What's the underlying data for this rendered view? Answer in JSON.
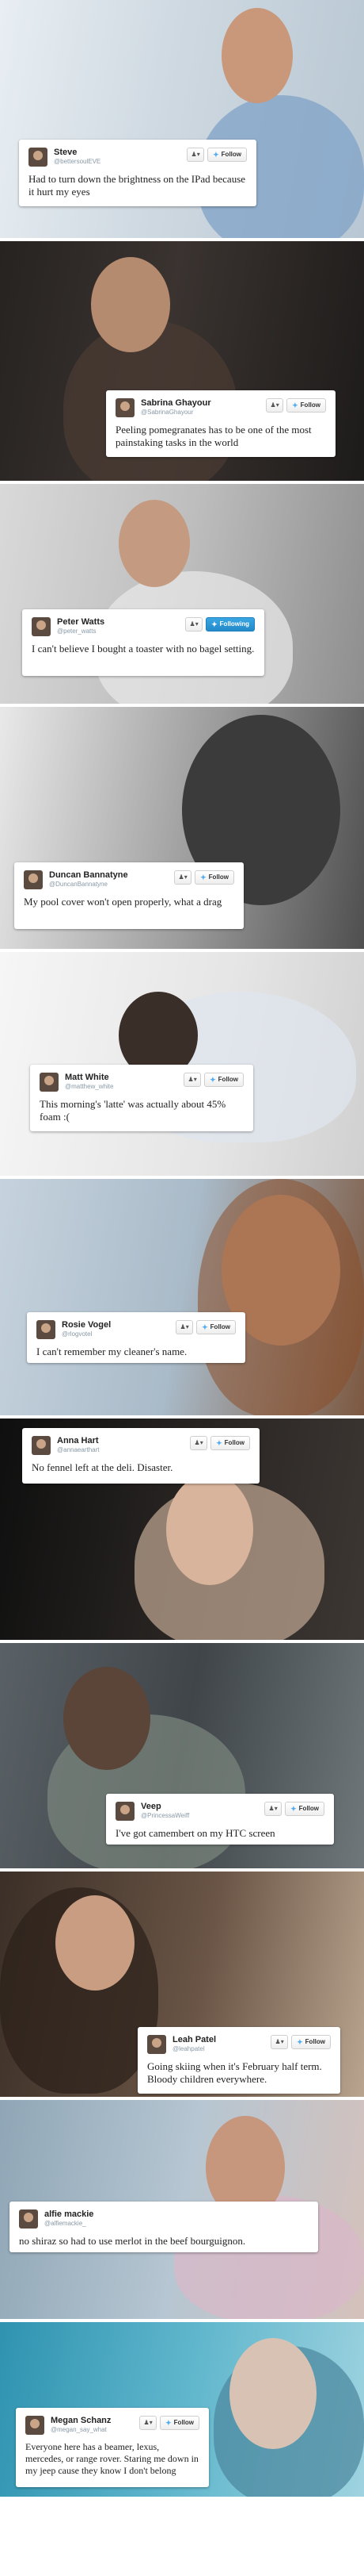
{
  "follow_label": "Follow",
  "following_label": "Following",
  "tweets": [
    {
      "name": "Steve",
      "handle": "@bettersoulEVE",
      "text": "Had to turn down the brightness on the IPad because it hurt my eyes",
      "following": false
    },
    {
      "name": "Sabrina Ghayour",
      "handle": "@SabrinaGhayour",
      "text": "Peeling pomegranates has to be one of the most painstaking tasks in the world",
      "following": false
    },
    {
      "name": "Peter Watts",
      "handle": "@peter_watts",
      "text": "I can't believe I bought a toaster with no bagel setting.",
      "following": true
    },
    {
      "name": "Duncan Bannatyne",
      "handle": "@DuncanBannatyne",
      "text": "My pool cover won't open properly, what a drag",
      "following": false
    },
    {
      "name": "Matt White",
      "handle": "@matthew_white",
      "text": "This morning's 'latte' was actually about 45% foam :(",
      "following": false
    },
    {
      "name": "Rosie Vogel",
      "handle": "@rlogvotel",
      "text": "I can't remember my cleaner's name.",
      "following": false
    },
    {
      "name": "Anna Hart",
      "handle": "@annaearthart",
      "text": "No fennel left at the deli. Disaster.",
      "following": false
    },
    {
      "name": "Veep",
      "handle": "@PrincessaWeiff",
      "text": "I've got camembert on my HTC screen",
      "following": false
    },
    {
      "name": "Leah Patel",
      "handle": "@leahpatel",
      "text": "Going skiing when it's February half term. Bloody children everywhere.",
      "following": false
    },
    {
      "name": "alfie mackie",
      "handle": "@alfiemackie_",
      "text": "no shiraz so had to use merlot in the beef bourguignon.",
      "following": false
    },
    {
      "name": "Megan Schanz",
      "handle": "@megan_say_what",
      "text": "Everyone here has a beamer, lexus, mercedes, or range rover. Staring me down in my jeep cause they know I don't belong",
      "following": false
    }
  ],
  "colors": {
    "twitter_blue": "#55acee",
    "following_blue": "#2389c9",
    "card_bg": "#ffffff",
    "name_text": "#222222",
    "handle_text": "#8899a6"
  },
  "icons": {
    "follow_icon": "person-plus-icon",
    "brand_icon": "twitter-bird-icon"
  }
}
